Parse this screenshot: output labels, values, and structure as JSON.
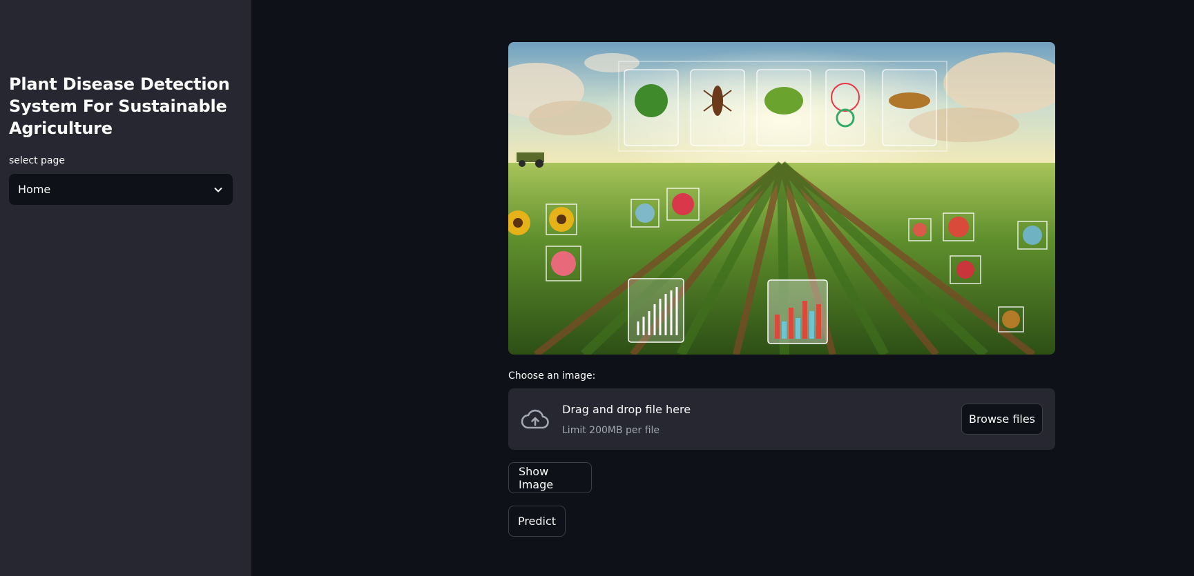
{
  "sidebar": {
    "title": "Plant Disease Detection System For Sustainable Agriculture",
    "select_label": "select page",
    "select_value": "Home"
  },
  "main": {
    "uploader_label": "Choose an image:",
    "dropzone": {
      "title": "Drag and drop file here",
      "limit": "Limit 200MB per file",
      "browse_label": "Browse files"
    },
    "show_image_label": "Show Image",
    "predict_label": "Predict"
  },
  "colors": {
    "background": "#0e1117",
    "sidebar": "#262730",
    "text": "#fafafa",
    "muted_text": "#a3a8b4"
  },
  "icons": {
    "select_chevron": "chevron-down-icon",
    "upload": "cloud-upload-icon"
  }
}
